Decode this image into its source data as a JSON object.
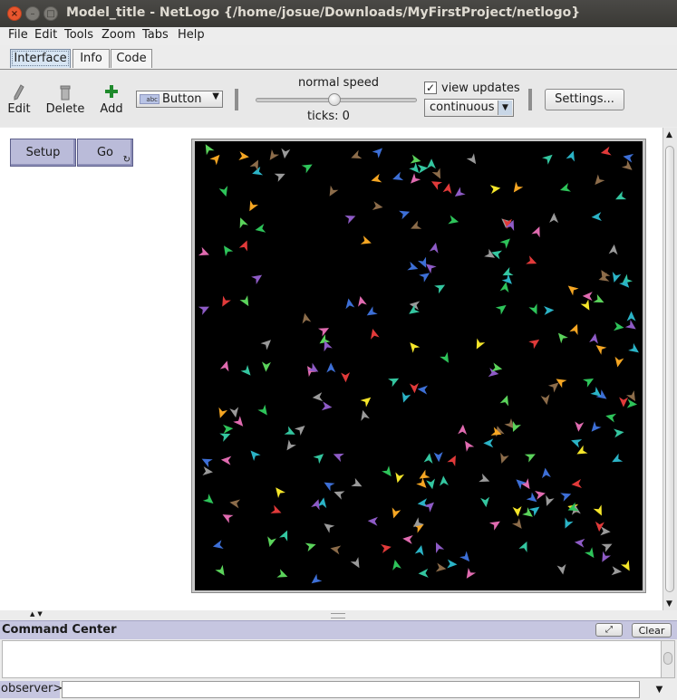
{
  "window": {
    "title": "Model_title - NetLogo {/home/josue/Downloads/MyFirstProject/netlogo}",
    "close_glyph": "×",
    "minimize_glyph": "–",
    "maximize_glyph": "□"
  },
  "menu": [
    "File",
    "Edit",
    "Tools",
    "Zoom",
    "Tabs",
    "Help"
  ],
  "tabs": [
    {
      "label": "Interface",
      "active": true
    },
    {
      "label": "Info",
      "active": false
    },
    {
      "label": "Code",
      "active": false
    }
  ],
  "toolbar": {
    "edit_label": "Edit",
    "delete_label": "Delete",
    "add_label": "Add",
    "widget_type": "Button",
    "widget_icon_text": "abc",
    "speed_label": "normal speed",
    "ticks_label": "ticks: 0",
    "view_updates_label": "view updates",
    "view_updates_checked": "✓",
    "update_mode": "continuous",
    "settings_label": "Settings..."
  },
  "interface": {
    "setup_label": "Setup",
    "go_label": "Go",
    "go_forever_icon": "↻"
  },
  "command_center": {
    "title": "Command Center",
    "clear_label": "Clear",
    "expand_glyph": "⤢",
    "prompt": "observer>"
  },
  "colors": {
    "world_background": "#000000",
    "button_fill": "#babbd9",
    "command_header": "#c6c6e0",
    "turtle_palette": [
      "#e13a3a",
      "#f5a623",
      "#f5e62a",
      "#2ec45a",
      "#2bb3c6",
      "#3d6fd6",
      "#8e5bc6",
      "#e06bb0",
      "#8c6c4a",
      "#9a9a9a",
      "#5bd35b",
      "#34c6a0"
    ]
  }
}
